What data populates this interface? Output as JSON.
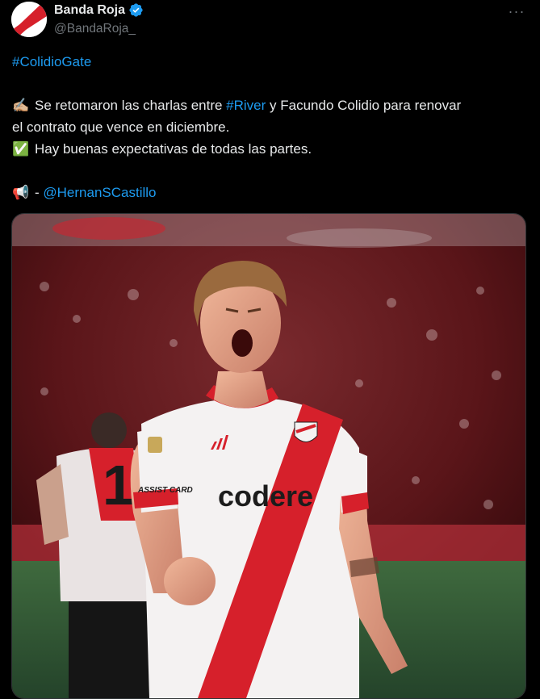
{
  "author": {
    "display_name": "Banda Roja",
    "handle": "@BandaRoja_",
    "verified": true
  },
  "more_label": "···",
  "tweet": {
    "hashtag_top": "#ColidioGate",
    "line1_prefix": "Se retomaron las charlas entre ",
    "line1_hashtag": "#River",
    "line1_suffix": " y Facundo Colidio para renovar",
    "line2": "el contrato que vence en diciembre.",
    "line3": "Hay buenas expectativas de todas las partes.",
    "credit_prefix": "- ",
    "credit_mention": "@HernanSCastillo",
    "emoji_writing": "✍🏼",
    "emoji_check": "✅",
    "emoji_megaphone": "📢"
  },
  "media": {
    "jersey_sponsor": "codere",
    "sleeve_sponsor": "ASSIST CARD",
    "back_number": "1"
  },
  "colors": {
    "background": "#000000",
    "text": "#e7e9ea",
    "muted": "#71767b",
    "link": "#1d9bf0",
    "verified": "#1d9bf0",
    "river_red": "#d6202b"
  },
  "icons": {
    "verified": "verified-badge-icon",
    "more": "more-options-icon",
    "writing": "writing-hand-icon",
    "check": "check-mark-icon",
    "megaphone": "megaphone-icon"
  }
}
